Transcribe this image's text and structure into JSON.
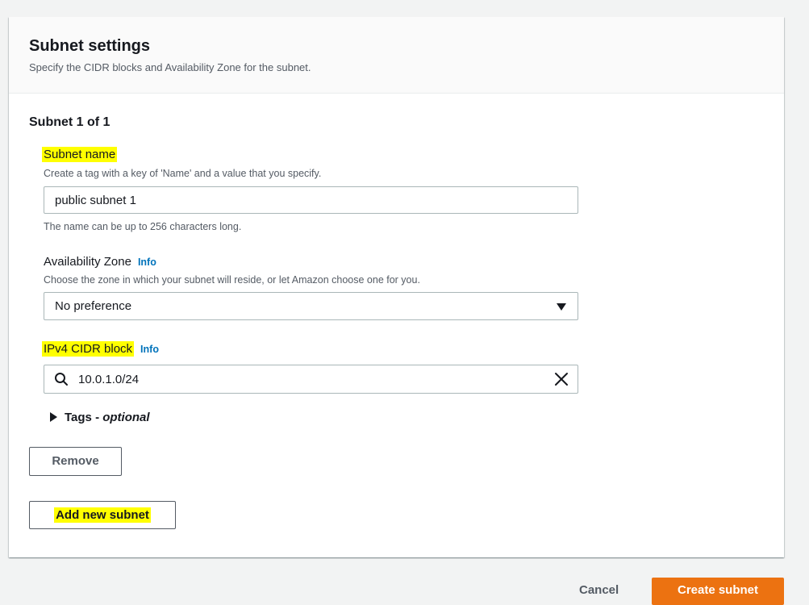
{
  "panel": {
    "title": "Subnet settings",
    "description": "Specify the CIDR blocks and Availability Zone for the subnet."
  },
  "subnet": {
    "heading": "Subnet 1 of 1",
    "name_field": {
      "label": "Subnet name",
      "description": "Create a tag with a key of 'Name' and a value that you specify.",
      "value": "public subnet 1",
      "hint": "The name can be up to 256 characters long."
    },
    "az_field": {
      "label": "Availability Zone",
      "info": "Info",
      "description": "Choose the zone in which your subnet will reside, or let Amazon choose one for you.",
      "selected": "No preference",
      "icon": "caret-down-icon"
    },
    "cidr_field": {
      "label": "IPv4 CIDR block",
      "info": "Info",
      "value": "10.0.1.0/24",
      "icons": [
        "search-icon",
        "clear-icon"
      ]
    },
    "tags": {
      "label": "Tags - ",
      "optional": "optional"
    },
    "remove_button": "Remove",
    "add_button": "Add new subnet"
  },
  "footer": {
    "cancel": "Cancel",
    "create": "Create subnet"
  },
  "colors": {
    "highlight": "#ffff00",
    "link": "#0073bb",
    "primary_button": "#ec7211",
    "background": "#f2f3f3"
  }
}
